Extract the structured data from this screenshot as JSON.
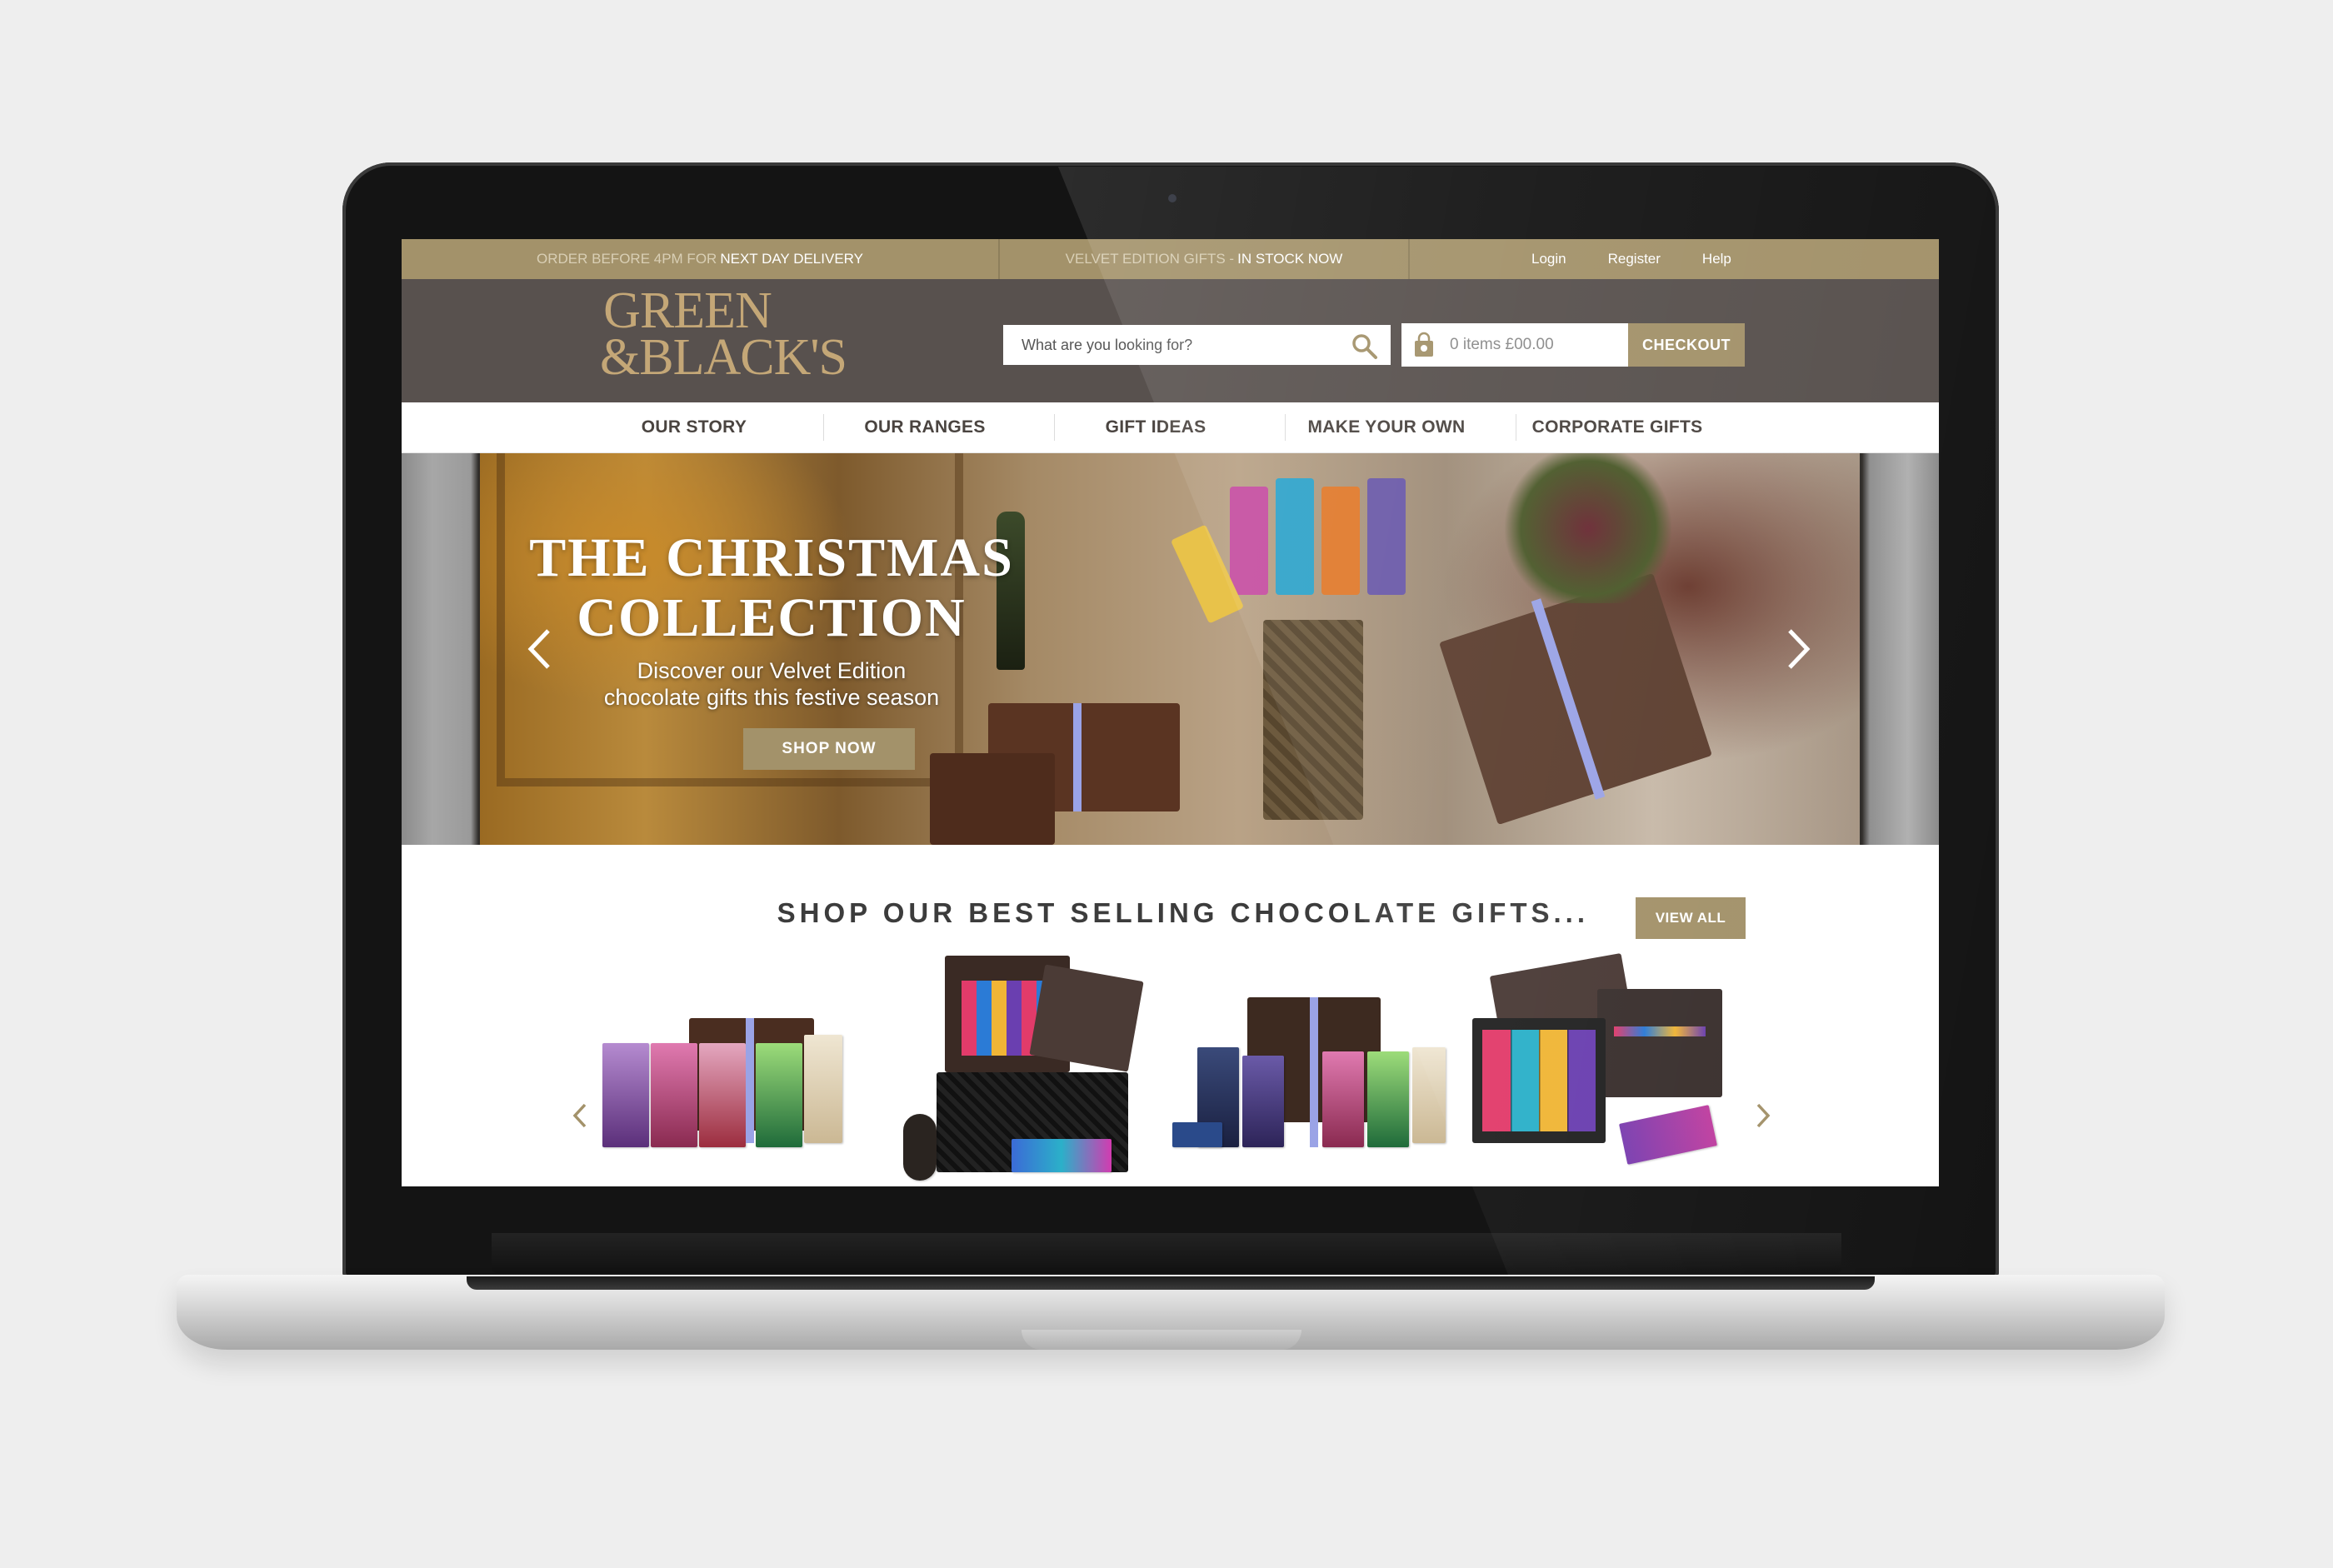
{
  "topbar": {
    "delivery_prefix": "ORDER BEFORE 4PM FOR",
    "delivery_highlight": "NEXT DAY DELIVERY",
    "gifts_prefix": "VELVET EDITION GIFTS -",
    "gifts_highlight": "IN STOCK NOW",
    "login": "Login",
    "register": "Register",
    "help": "Help"
  },
  "header": {
    "logo_line1": "GREEN",
    "logo_line2": "&BLACK'S",
    "search_placeholder": "What are you looking for?",
    "basket_text": "0 items £00.00",
    "checkout_label": "CHECKOUT"
  },
  "nav": {
    "items": [
      "OUR STORY",
      "OUR RANGES",
      "GIFT IDEAS",
      "MAKE YOUR OWN",
      "CORPORATE GIFTS"
    ]
  },
  "hero": {
    "title_line1": "THE CHRISTMAS",
    "title_line2": "COLLECTION",
    "subtitle_line1": "Discover our Velvet Edition",
    "subtitle_line2": "chocolate gifts this festive season",
    "cta_label": "SHOP NOW"
  },
  "bestsellers": {
    "title": "SHOP OUR BEST SELLING CHOCOLATE GIFTS...",
    "view_all_label": "VIEW ALL"
  },
  "colors": {
    "gold": "#a3926a",
    "header_bg": "#58514e",
    "logo_gold": "#c4a777",
    "ribbon": "#9aa3e6"
  },
  "icons": [
    "search-icon",
    "shopping-bag-icon",
    "chevron-left-icon",
    "chevron-right-icon"
  ]
}
